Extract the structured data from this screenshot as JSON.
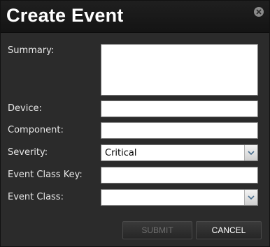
{
  "dialog": {
    "title": "Create Event",
    "close_icon": "close-icon"
  },
  "fields": {
    "summary": {
      "label": "Summary:",
      "value": ""
    },
    "device": {
      "label": "Device:",
      "value": ""
    },
    "component": {
      "label": "Component:",
      "value": ""
    },
    "severity": {
      "label": "Severity:",
      "value": "Critical"
    },
    "event_class_key": {
      "label": "Event Class Key:",
      "value": ""
    },
    "event_class": {
      "label": "Event Class:",
      "value": ""
    }
  },
  "buttons": {
    "submit_label": "SUBMIT",
    "submit_disabled": "true",
    "cancel_label": "CANCEL"
  },
  "colors": {
    "dialog_background": "#2b2b2b",
    "titlebar_background": "#1a1a1a",
    "label_text": "#e6e6e6",
    "disabled_button_text": "#6e6e6e"
  }
}
